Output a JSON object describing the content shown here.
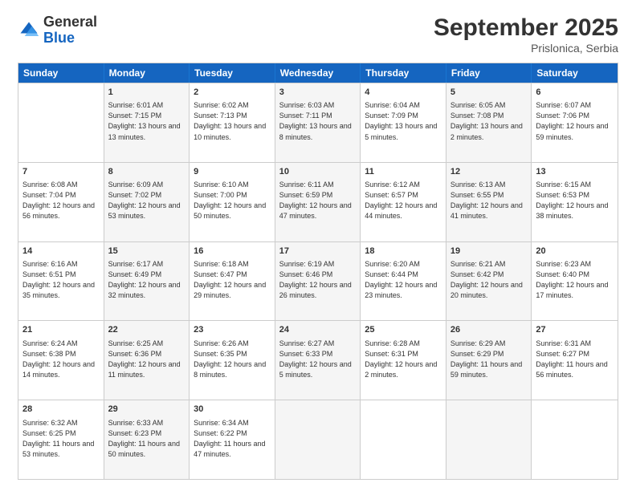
{
  "logo": {
    "general": "General",
    "blue": "Blue"
  },
  "title": {
    "month_year": "September 2025",
    "location": "Prislonica, Serbia"
  },
  "header_days": [
    "Sunday",
    "Monday",
    "Tuesday",
    "Wednesday",
    "Thursday",
    "Friday",
    "Saturday"
  ],
  "weeks": [
    [
      {
        "day": "",
        "sunrise": "",
        "sunset": "",
        "daylight": "",
        "shaded": false
      },
      {
        "day": "1",
        "sunrise": "Sunrise: 6:01 AM",
        "sunset": "Sunset: 7:15 PM",
        "daylight": "Daylight: 13 hours and 13 minutes.",
        "shaded": true
      },
      {
        "day": "2",
        "sunrise": "Sunrise: 6:02 AM",
        "sunset": "Sunset: 7:13 PM",
        "daylight": "Daylight: 13 hours and 10 minutes.",
        "shaded": false
      },
      {
        "day": "3",
        "sunrise": "Sunrise: 6:03 AM",
        "sunset": "Sunset: 7:11 PM",
        "daylight": "Daylight: 13 hours and 8 minutes.",
        "shaded": true
      },
      {
        "day": "4",
        "sunrise": "Sunrise: 6:04 AM",
        "sunset": "Sunset: 7:09 PM",
        "daylight": "Daylight: 13 hours and 5 minutes.",
        "shaded": false
      },
      {
        "day": "5",
        "sunrise": "Sunrise: 6:05 AM",
        "sunset": "Sunset: 7:08 PM",
        "daylight": "Daylight: 13 hours and 2 minutes.",
        "shaded": true
      },
      {
        "day": "6",
        "sunrise": "Sunrise: 6:07 AM",
        "sunset": "Sunset: 7:06 PM",
        "daylight": "Daylight: 12 hours and 59 minutes.",
        "shaded": false
      }
    ],
    [
      {
        "day": "7",
        "sunrise": "Sunrise: 6:08 AM",
        "sunset": "Sunset: 7:04 PM",
        "daylight": "Daylight: 12 hours and 56 minutes.",
        "shaded": false
      },
      {
        "day": "8",
        "sunrise": "Sunrise: 6:09 AM",
        "sunset": "Sunset: 7:02 PM",
        "daylight": "Daylight: 12 hours and 53 minutes.",
        "shaded": true
      },
      {
        "day": "9",
        "sunrise": "Sunrise: 6:10 AM",
        "sunset": "Sunset: 7:00 PM",
        "daylight": "Daylight: 12 hours and 50 minutes.",
        "shaded": false
      },
      {
        "day": "10",
        "sunrise": "Sunrise: 6:11 AM",
        "sunset": "Sunset: 6:59 PM",
        "daylight": "Daylight: 12 hours and 47 minutes.",
        "shaded": true
      },
      {
        "day": "11",
        "sunrise": "Sunrise: 6:12 AM",
        "sunset": "Sunset: 6:57 PM",
        "daylight": "Daylight: 12 hours and 44 minutes.",
        "shaded": false
      },
      {
        "day": "12",
        "sunrise": "Sunrise: 6:13 AM",
        "sunset": "Sunset: 6:55 PM",
        "daylight": "Daylight: 12 hours and 41 minutes.",
        "shaded": true
      },
      {
        "day": "13",
        "sunrise": "Sunrise: 6:15 AM",
        "sunset": "Sunset: 6:53 PM",
        "daylight": "Daylight: 12 hours and 38 minutes.",
        "shaded": false
      }
    ],
    [
      {
        "day": "14",
        "sunrise": "Sunrise: 6:16 AM",
        "sunset": "Sunset: 6:51 PM",
        "daylight": "Daylight: 12 hours and 35 minutes.",
        "shaded": false
      },
      {
        "day": "15",
        "sunrise": "Sunrise: 6:17 AM",
        "sunset": "Sunset: 6:49 PM",
        "daylight": "Daylight: 12 hours and 32 minutes.",
        "shaded": true
      },
      {
        "day": "16",
        "sunrise": "Sunrise: 6:18 AM",
        "sunset": "Sunset: 6:47 PM",
        "daylight": "Daylight: 12 hours and 29 minutes.",
        "shaded": false
      },
      {
        "day": "17",
        "sunrise": "Sunrise: 6:19 AM",
        "sunset": "Sunset: 6:46 PM",
        "daylight": "Daylight: 12 hours and 26 minutes.",
        "shaded": true
      },
      {
        "day": "18",
        "sunrise": "Sunrise: 6:20 AM",
        "sunset": "Sunset: 6:44 PM",
        "daylight": "Daylight: 12 hours and 23 minutes.",
        "shaded": false
      },
      {
        "day": "19",
        "sunrise": "Sunrise: 6:21 AM",
        "sunset": "Sunset: 6:42 PM",
        "daylight": "Daylight: 12 hours and 20 minutes.",
        "shaded": true
      },
      {
        "day": "20",
        "sunrise": "Sunrise: 6:23 AM",
        "sunset": "Sunset: 6:40 PM",
        "daylight": "Daylight: 12 hours and 17 minutes.",
        "shaded": false
      }
    ],
    [
      {
        "day": "21",
        "sunrise": "Sunrise: 6:24 AM",
        "sunset": "Sunset: 6:38 PM",
        "daylight": "Daylight: 12 hours and 14 minutes.",
        "shaded": false
      },
      {
        "day": "22",
        "sunrise": "Sunrise: 6:25 AM",
        "sunset": "Sunset: 6:36 PM",
        "daylight": "Daylight: 12 hours and 11 minutes.",
        "shaded": true
      },
      {
        "day": "23",
        "sunrise": "Sunrise: 6:26 AM",
        "sunset": "Sunset: 6:35 PM",
        "daylight": "Daylight: 12 hours and 8 minutes.",
        "shaded": false
      },
      {
        "day": "24",
        "sunrise": "Sunrise: 6:27 AM",
        "sunset": "Sunset: 6:33 PM",
        "daylight": "Daylight: 12 hours and 5 minutes.",
        "shaded": true
      },
      {
        "day": "25",
        "sunrise": "Sunrise: 6:28 AM",
        "sunset": "Sunset: 6:31 PM",
        "daylight": "Daylight: 12 hours and 2 minutes.",
        "shaded": false
      },
      {
        "day": "26",
        "sunrise": "Sunrise: 6:29 AM",
        "sunset": "Sunset: 6:29 PM",
        "daylight": "Daylight: 11 hours and 59 minutes.",
        "shaded": true
      },
      {
        "day": "27",
        "sunrise": "Sunrise: 6:31 AM",
        "sunset": "Sunset: 6:27 PM",
        "daylight": "Daylight: 11 hours and 56 minutes.",
        "shaded": false
      }
    ],
    [
      {
        "day": "28",
        "sunrise": "Sunrise: 6:32 AM",
        "sunset": "Sunset: 6:25 PM",
        "daylight": "Daylight: 11 hours and 53 minutes.",
        "shaded": false
      },
      {
        "day": "29",
        "sunrise": "Sunrise: 6:33 AM",
        "sunset": "Sunset: 6:23 PM",
        "daylight": "Daylight: 11 hours and 50 minutes.",
        "shaded": true
      },
      {
        "day": "30",
        "sunrise": "Sunrise: 6:34 AM",
        "sunset": "Sunset: 6:22 PM",
        "daylight": "Daylight: 11 hours and 47 minutes.",
        "shaded": false
      },
      {
        "day": "",
        "sunrise": "",
        "sunset": "",
        "daylight": "",
        "shaded": true
      },
      {
        "day": "",
        "sunrise": "",
        "sunset": "",
        "daylight": "",
        "shaded": false
      },
      {
        "day": "",
        "sunrise": "",
        "sunset": "",
        "daylight": "",
        "shaded": true
      },
      {
        "day": "",
        "sunrise": "",
        "sunset": "",
        "daylight": "",
        "shaded": false
      }
    ]
  ]
}
